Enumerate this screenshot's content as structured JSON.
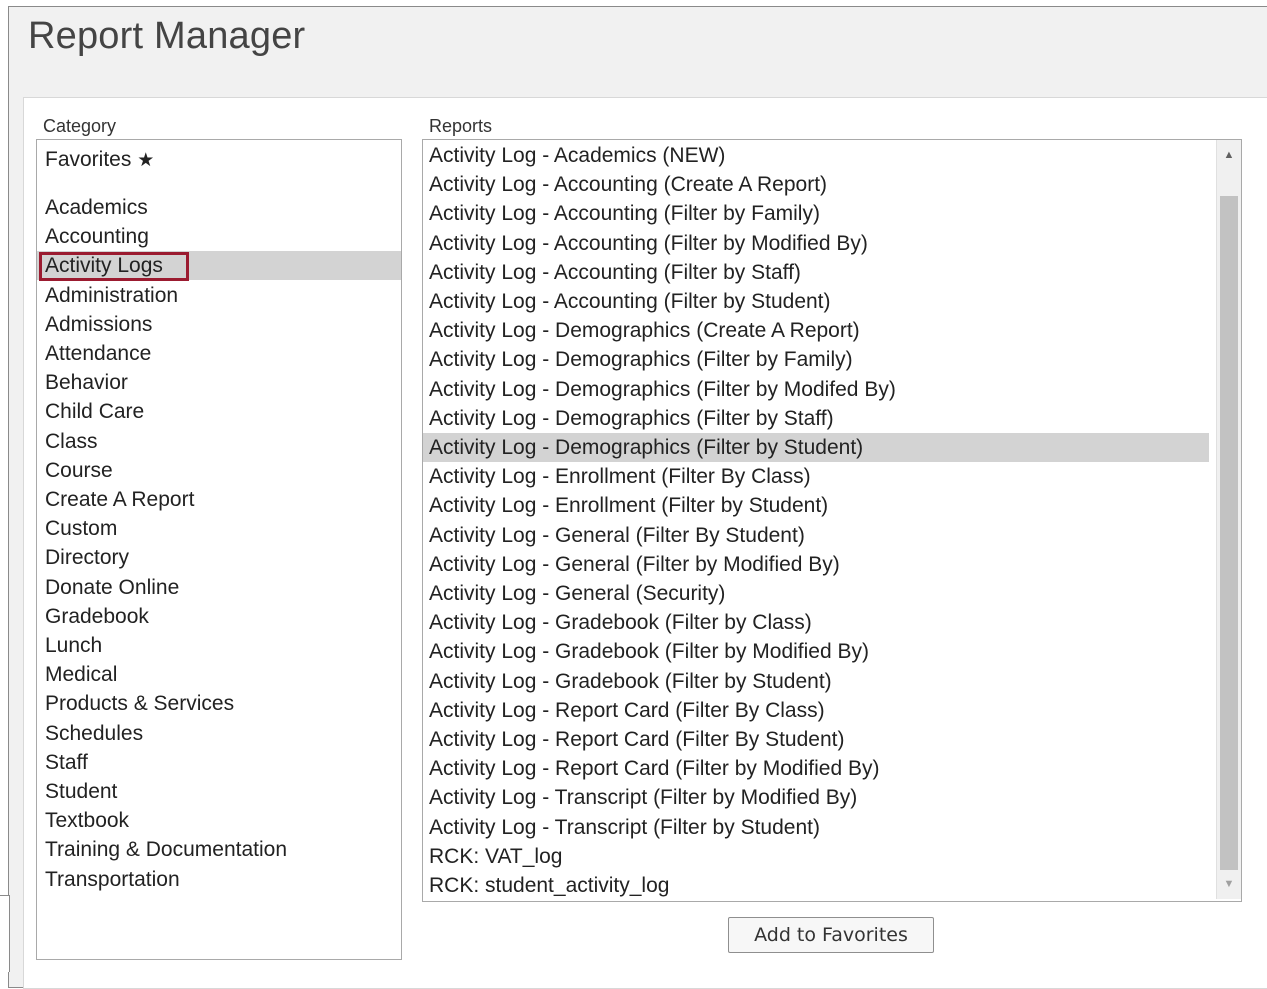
{
  "app": {
    "title": "Report Manager"
  },
  "category": {
    "label": "Category",
    "favorites_label": "Favorites",
    "favorites_icon": "star-icon",
    "star_glyph": "★",
    "items": [
      "Academics",
      "Accounting",
      "Activity Logs",
      "Administration",
      "Admissions",
      "Attendance",
      "Behavior",
      "Child Care",
      "Class",
      "Course",
      "Create A Report",
      "Custom",
      "Directory",
      "Donate Online",
      "Gradebook",
      "Lunch",
      "Medical",
      "Products & Services",
      "Schedules",
      "Staff",
      "Student",
      "Textbook",
      "Training & Documentation",
      "Transportation"
    ],
    "selected": "Activity Logs"
  },
  "reports": {
    "label": "Reports",
    "items": [
      "Activity Log - Academics (NEW)",
      "Activity Log - Accounting (Create A Report)",
      "Activity Log - Accounting (Filter by Family)",
      "Activity Log - Accounting (Filter by Modified By)",
      "Activity Log - Accounting (Filter by Staff)",
      "Activity Log - Accounting (Filter by Student)",
      "Activity Log - Demographics (Create A Report)",
      "Activity Log - Demographics (Filter by Family)",
      "Activity Log - Demographics (Filter by Modifed By)",
      "Activity Log - Demographics (Filter by Staff)",
      "Activity Log - Demographics (Filter by Student)",
      "Activity Log - Enrollment (Filter By Class)",
      "Activity Log - Enrollment (Filter by Student)",
      "Activity Log - General (Filter By Student)",
      "Activity Log - General (Filter by Modified By)",
      "Activity Log - General (Security)",
      "Activity Log - Gradebook (Filter by Class)",
      "Activity Log - Gradebook (Filter by Modified By)",
      "Activity Log - Gradebook (Filter by Student)",
      "Activity Log - Report Card (Filter By Class)",
      "Activity Log - Report Card (Filter By Student)",
      "Activity Log - Report Card (Filter by Modified By)",
      "Activity Log - Transcript (Filter by Modified By)",
      "Activity Log - Transcript (Filter by Student)",
      "RCK: VAT_log",
      "RCK: student_activity_log"
    ],
    "selected": "Activity Log - Demographics (Filter by Student)",
    "scroll_up_icon": "▲",
    "scroll_down_icon": "▼"
  },
  "buttons": {
    "add_to_favorites": "Add to Favorites"
  },
  "colors": {
    "selection": "#d3d3d3",
    "highlight_border": "#9b1b30"
  }
}
